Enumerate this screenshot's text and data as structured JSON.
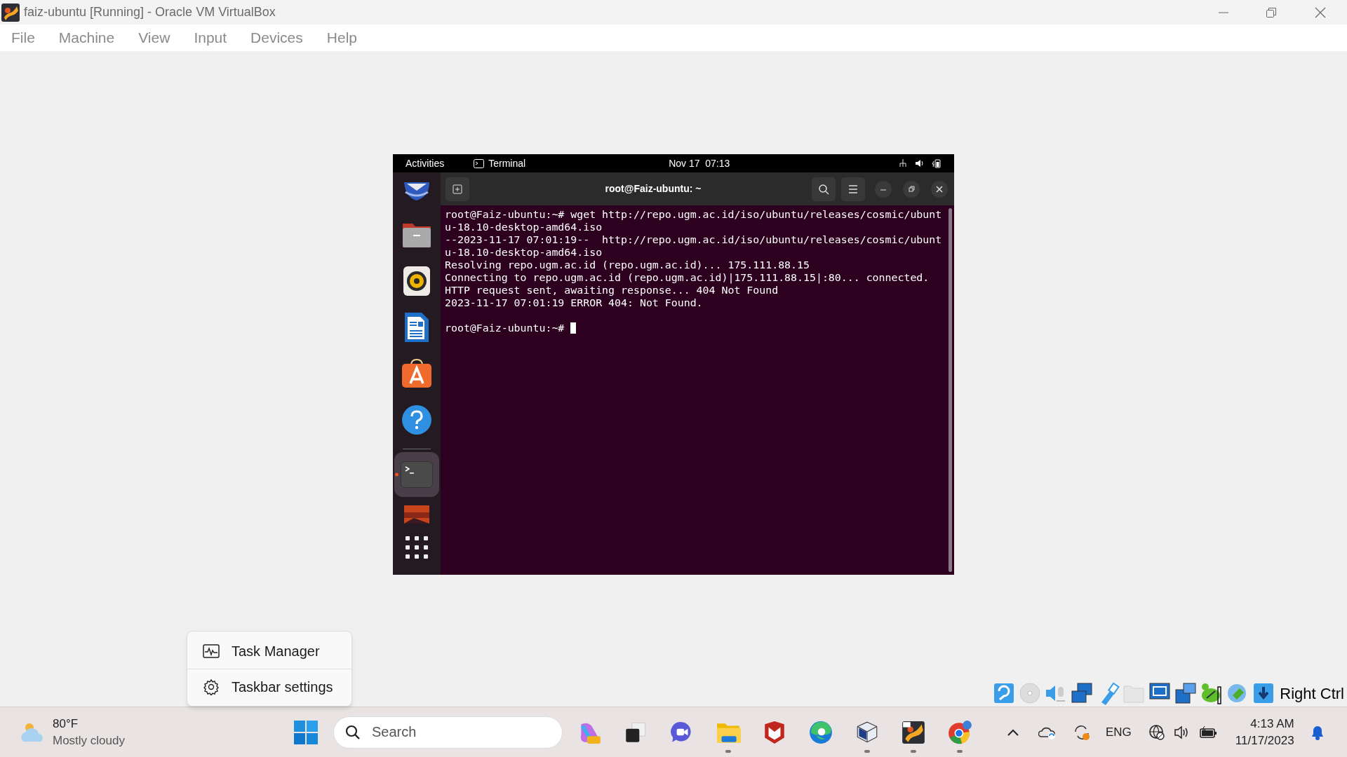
{
  "window": {
    "title": "faiz-ubuntu [Running] - Oracle VM VirtualBox"
  },
  "menu_bar": [
    "File",
    "Machine",
    "View",
    "Input",
    "Devices",
    "Help"
  ],
  "vm_screen": {
    "top_bar": {
      "activities": "Activities",
      "app": "Terminal",
      "clock": "Nov 17  07:13"
    },
    "dock": [
      {
        "kind": "mail",
        "selected": false,
        "running": false
      },
      {
        "kind": "files",
        "selected": false,
        "running": false
      },
      {
        "kind": "music",
        "selected": false,
        "running": false
      },
      {
        "kind": "writer",
        "selected": false,
        "running": false
      },
      {
        "kind": "software",
        "selected": false,
        "running": false
      },
      {
        "kind": "help",
        "selected": false,
        "running": false
      },
      {
        "kind": "terminal",
        "selected": true,
        "running": true
      },
      {
        "kind": "image",
        "selected": false,
        "running": false
      },
      {
        "kind": "apps",
        "selected": false,
        "running": false
      }
    ],
    "terminal": {
      "title": "root@Faiz-ubuntu: ~",
      "lines": [
        "root@Faiz-ubuntu:~# wget http://repo.ugm.ac.id/iso/ubuntu/releases/cosmic/ubunt",
        "u-18.10-desktop-amd64.iso",
        "--2023-11-17 07:01:19--  http://repo.ugm.ac.id/iso/ubuntu/releases/cosmic/ubunt",
        "u-18.10-desktop-amd64.iso",
        "Resolving repo.ugm.ac.id (repo.ugm.ac.id)... 175.111.88.15",
        "Connecting to repo.ugm.ac.id (repo.ugm.ac.id)|175.111.88.15|:80... connected.",
        "HTTP request sent, awaiting response... 404 Not Found",
        "2023-11-17 07:01:19 ERROR 404: Not Found."
      ],
      "prompt": "root@Faiz-ubuntu:~#"
    }
  },
  "context_menu": [
    {
      "kind": "task-manager",
      "label": "Task Manager"
    },
    {
      "kind": "settings",
      "label": "Taskbar settings"
    }
  ],
  "status_bar": {
    "host_key": "Right Ctrl"
  },
  "taskbar": {
    "weather": {
      "temperature": "80°F",
      "condition": "Mostly cloudy"
    },
    "search": {
      "placeholder": "Search"
    },
    "apps": [
      {
        "kind": "copilot",
        "running": false
      },
      {
        "kind": "task-view",
        "running": false
      },
      {
        "kind": "chat",
        "running": false
      },
      {
        "kind": "explorer",
        "running": true
      },
      {
        "kind": "shield",
        "running": false
      },
      {
        "kind": "edge",
        "running": false
      },
      {
        "kind": "virtualbox",
        "running": true
      },
      {
        "kind": "virtualbox64",
        "running": true
      },
      {
        "kind": "chrome",
        "running": true
      }
    ],
    "language": "ENG",
    "time": "4:13 AM",
    "date": "11/17/2023"
  }
}
